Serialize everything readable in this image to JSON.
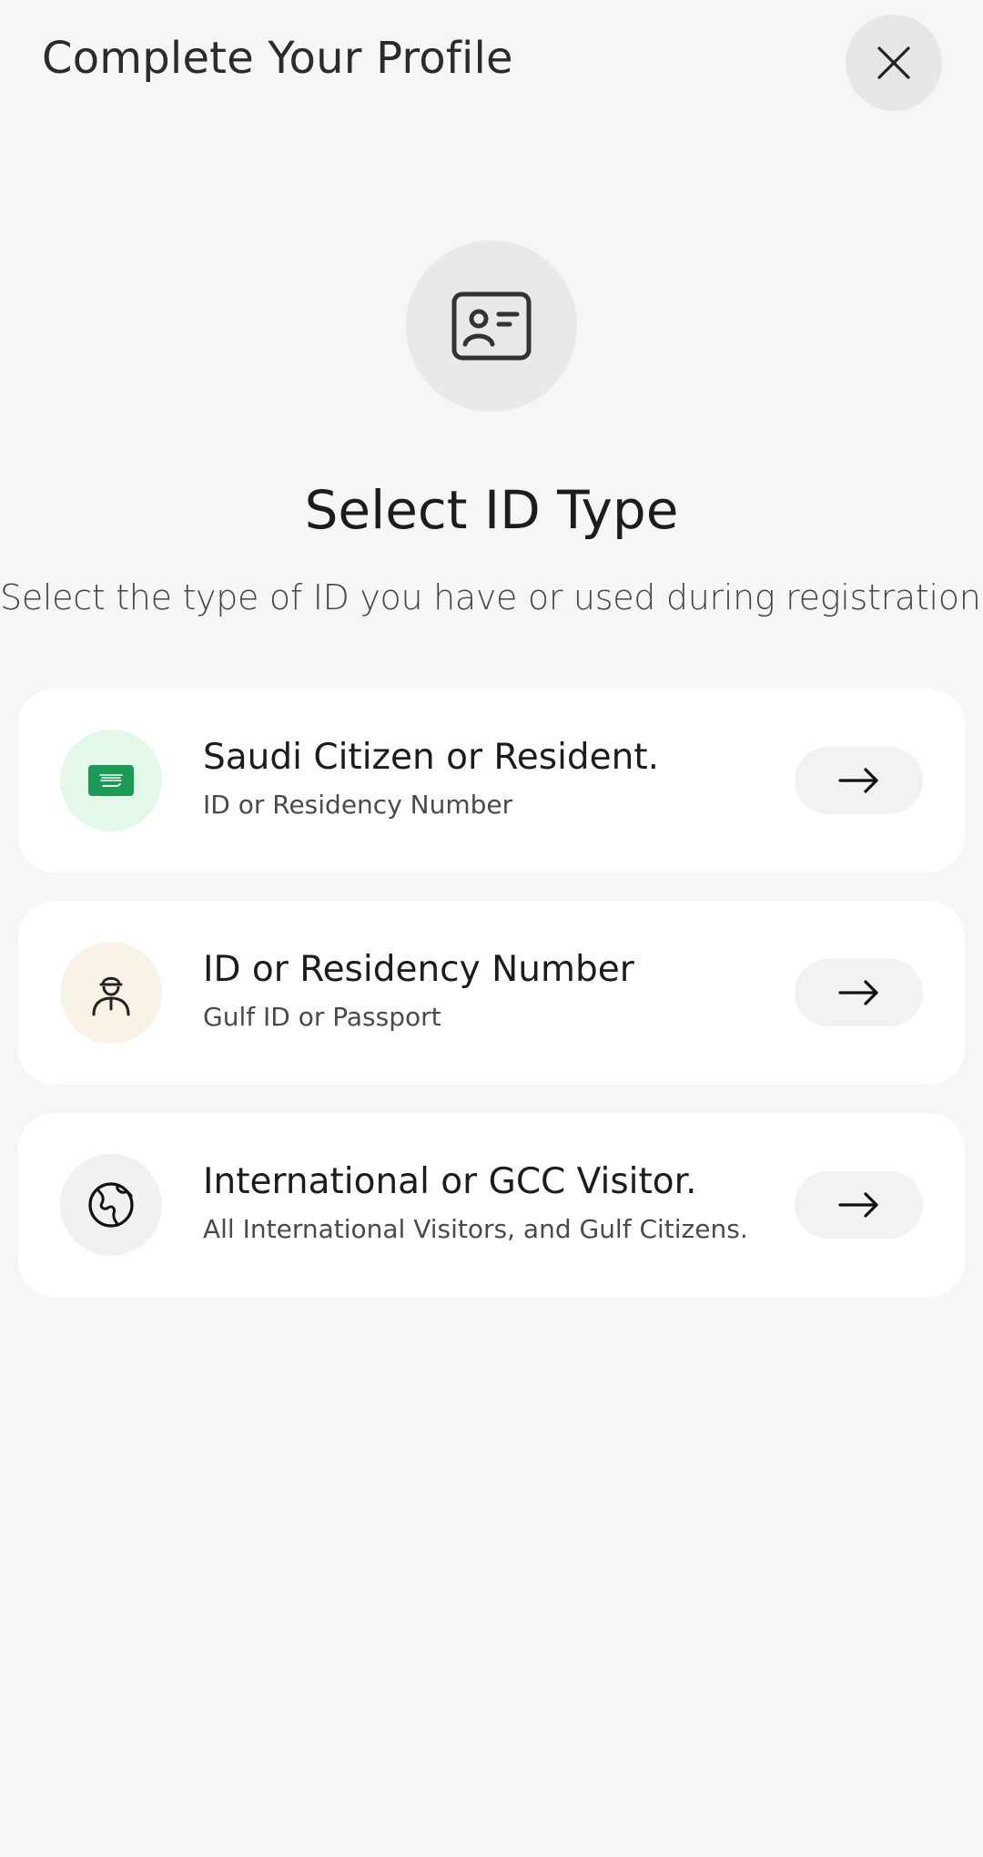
{
  "header": {
    "title": "Complete Your Profile"
  },
  "main": {
    "title": "Select ID Type",
    "subtitle": "Select the type of ID you have or used during registration."
  },
  "options": [
    {
      "title": "Saudi Citizen or Resident.",
      "description": "ID or Residency Number",
      "icon": "saudi-flag-icon",
      "icon_bg": "#e4f8e9"
    },
    {
      "title": "ID or Residency Number",
      "description": "Gulf ID or Passport",
      "icon": "person-icon",
      "icon_bg": "#f9f2e6"
    },
    {
      "title": "International or GCC Visitor.",
      "description": "All International Visitors, and Gulf Citizens.",
      "icon": "globe-icon",
      "icon_bg": "#f1f1f1"
    }
  ],
  "colors": {
    "background": "#f6f6f6",
    "card": "#ffffff",
    "flag_green": "#1c9a55"
  }
}
